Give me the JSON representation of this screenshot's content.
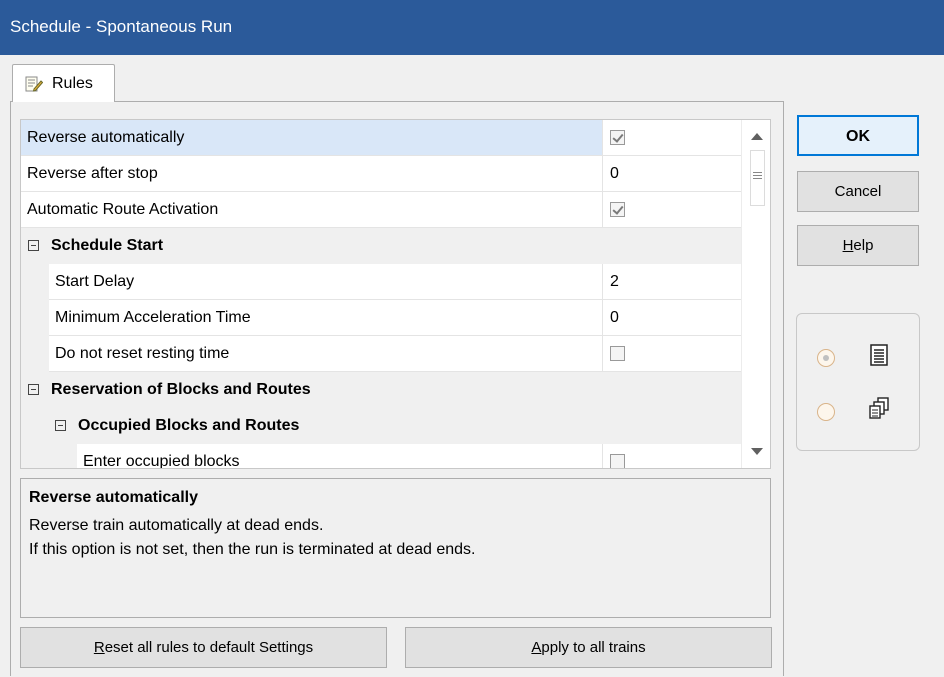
{
  "window": {
    "title": "Schedule - Spontaneous Run"
  },
  "tab": {
    "label": "Rules",
    "icon": "rules-edit-icon"
  },
  "rules": [
    {
      "label": "Reverse automatically",
      "type": "checkbox",
      "checked": true,
      "selected": true
    },
    {
      "label": "Reverse after stop",
      "type": "text",
      "value": "0"
    },
    {
      "label": "Automatic Route Activation",
      "type": "checkbox",
      "checked": true
    },
    {
      "label": "Schedule Start",
      "type": "category",
      "expanded": true
    },
    {
      "label": "Start Delay",
      "type": "text",
      "value": "2"
    },
    {
      "label": "Minimum Acceleration Time",
      "type": "text",
      "value": "0"
    },
    {
      "label": "Do not reset resting time",
      "type": "checkbox",
      "checked": false
    },
    {
      "label": "Reservation of Blocks and Routes",
      "type": "category",
      "expanded": true
    },
    {
      "label": "Occupied Blocks and Routes",
      "type": "category",
      "expanded": true
    },
    {
      "label": "Enter occupied blocks",
      "type": "checkbox",
      "checked": false
    }
  ],
  "description": {
    "title": "Reverse automatically",
    "line1": "Reverse train automatically at dead ends.",
    "line2": "If this option is not set, then the run is terminated at dead ends."
  },
  "buttons": {
    "reset_prefix": "R",
    "reset_rest": "eset all rules to default Settings",
    "apply_prefix": "A",
    "apply_rest": "pply to all trains",
    "ok": "OK",
    "cancel": "Cancel",
    "help_prefix": "H",
    "help_rest": "elp"
  },
  "view_options": [
    {
      "icon": "single-list-icon",
      "selected": true
    },
    {
      "icon": "multi-copy-icon",
      "selected": false
    }
  ]
}
